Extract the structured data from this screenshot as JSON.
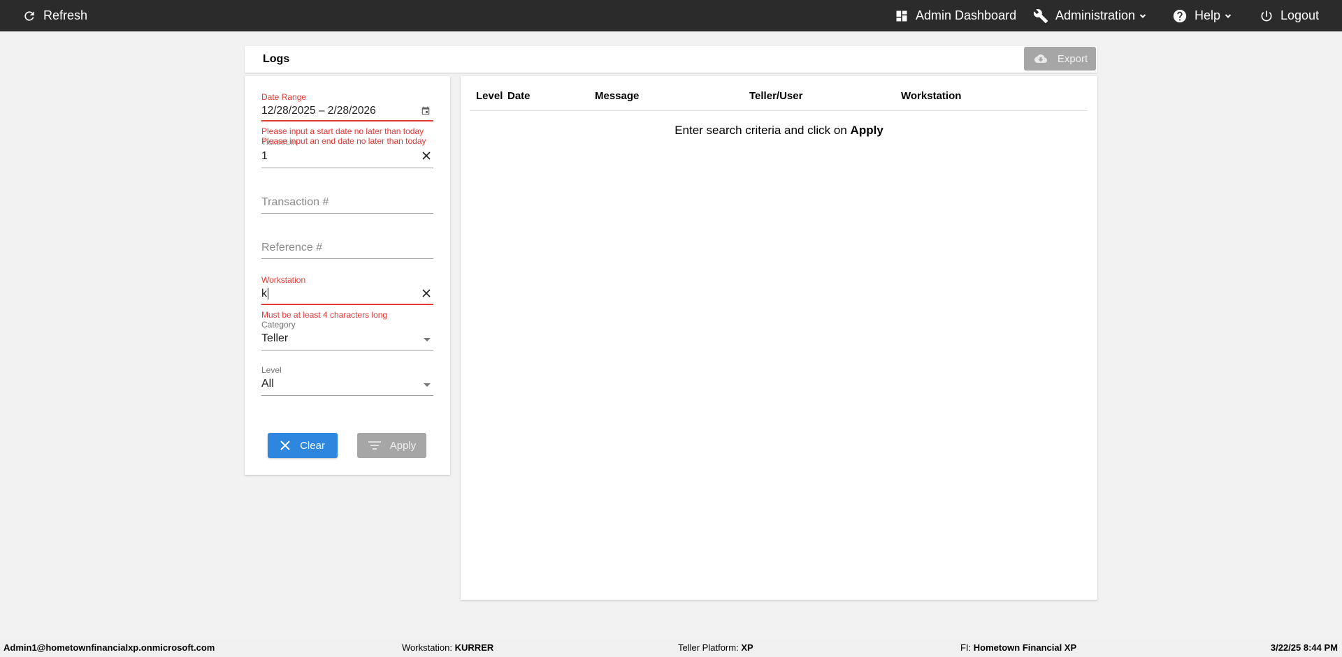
{
  "topbar": {
    "refresh_label": "Refresh",
    "admin_dashboard_label": "Admin Dashboard",
    "administration_label": "Administration",
    "help_label": "Help",
    "logout_label": "Logout",
    "icons": [
      "refresh-icon",
      "dashboard-icon",
      "wrench-icon",
      "help-icon",
      "power-icon",
      "chevron-down-icon"
    ]
  },
  "logs": {
    "title": "Logs",
    "export_label": "Export"
  },
  "filters": {
    "date_range": {
      "label": "Date Range",
      "value": "12/28/2025 – 2/28/2026",
      "error_start": "Please input a start date no later than today",
      "error_end": "Please input an end date no later than today"
    },
    "ticket": {
      "label": "Ticket/Lin",
      "value": "1"
    },
    "transaction": {
      "placeholder": "Transaction #"
    },
    "reference": {
      "placeholder": "Reference #"
    },
    "workstation": {
      "label": "Workstation",
      "value": "k",
      "error": "Must be at least 4 characters long"
    },
    "category": {
      "label": "Category",
      "value": "Teller"
    },
    "level": {
      "label": "Level",
      "value": "All"
    },
    "clear_label": "Clear",
    "apply_label": "Apply"
  },
  "results": {
    "columns": [
      "Level",
      "Date",
      "Message",
      "Teller/User",
      "Workstation"
    ],
    "empty_prefix": "Enter search criteria and click on ",
    "empty_action": "Apply"
  },
  "statusbar": {
    "user": "Admin1@hometownfinancialxp.onmicrosoft.com",
    "workstation_label": "Workstation:",
    "workstation_value": "KURRER",
    "platform_label": "Teller Platform:",
    "platform_value": "XP",
    "fi_label": "FI:",
    "fi_value": "Hometown Financial XP",
    "datetime": "3/22/25 8:44 PM"
  },
  "colors": {
    "topbar_bg": "#2b2b2b",
    "error": "#e53935",
    "clear_button": "#2e86de",
    "disabled_button": "#a6a6a6"
  }
}
